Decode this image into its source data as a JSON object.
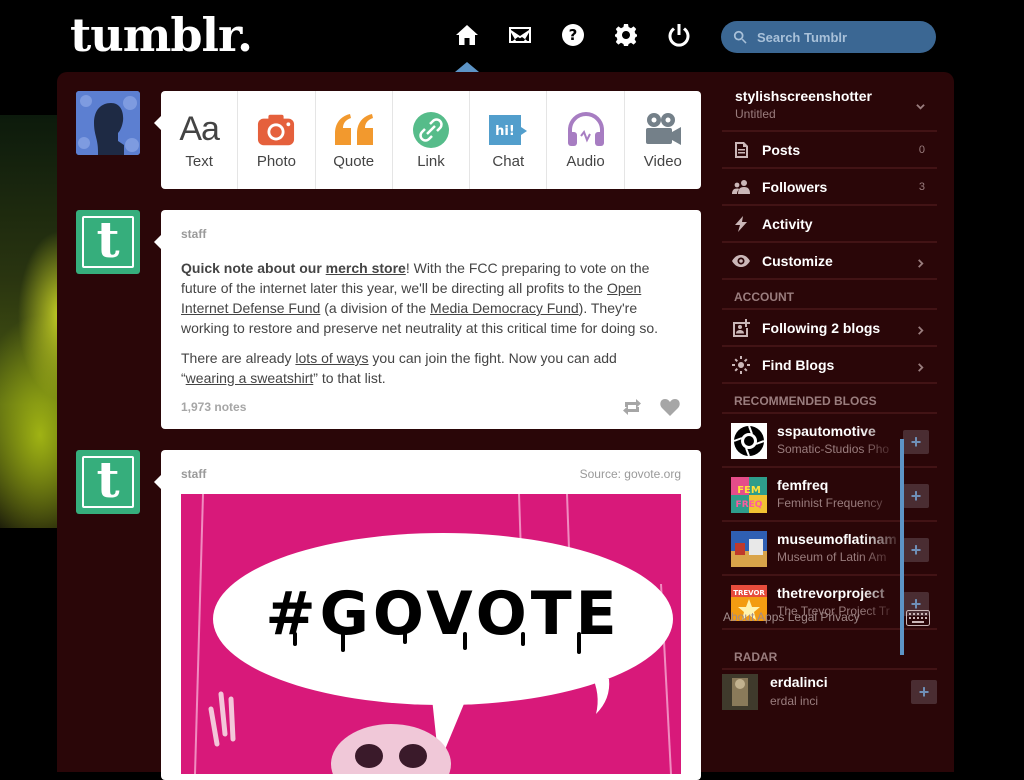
{
  "header": {
    "logo": "tumblr.",
    "nav": [
      {
        "id": "home",
        "icon": "home-icon"
      },
      {
        "id": "inbox",
        "icon": "envelope-icon"
      },
      {
        "id": "help",
        "icon": "question-icon"
      },
      {
        "id": "settings",
        "icon": "gear-icon"
      },
      {
        "id": "logout",
        "icon": "power-icon"
      }
    ],
    "search_placeholder": "Search Tumblr"
  },
  "post_types": [
    {
      "label": "Text",
      "icon": "text-icon",
      "color": "#444444"
    },
    {
      "label": "Photo",
      "icon": "camera-icon",
      "color": "#e5603c"
    },
    {
      "label": "Quote",
      "icon": "quote-icon",
      "color": "#f2992e"
    },
    {
      "label": "Link",
      "icon": "link-icon",
      "color": "#56bc8a"
    },
    {
      "label": "Chat",
      "icon": "chat-icon",
      "color": "#529ecc"
    },
    {
      "label": "Audio",
      "icon": "headphones-icon",
      "color": "#a77dc2"
    },
    {
      "label": "Video",
      "icon": "video-camera-icon",
      "color": "#748089"
    }
  ],
  "posts": [
    {
      "blog": "staff",
      "p1_lead": "Quick note about our ",
      "p1_link1": "merch store",
      "p1_after1": "! With the FCC preparing to vote on the future of the internet later this year, we'll be directing all profits to the ",
      "p1_link2": "Open Internet Defense Fund",
      "p1_after2": " (a division of the ",
      "p1_link3": "Media Democracy Fund",
      "p1_after3": "). They're working to restore and preserve net neutrality at this critical time for doing so.",
      "p2_lead": "There are already ",
      "p2_link1": "lots of ways",
      "p2_after1": " you can join the fight. Now you can add “",
      "p2_link2": "wearing a sweatshirt",
      "p2_after2": "” to that list.",
      "notes": "1,973 notes"
    },
    {
      "blog": "staff",
      "source": "Source: govote.org",
      "image_text": "#GOVOTE"
    }
  ],
  "sidebar": {
    "blog_name": "stylishscreenshotter",
    "blog_title": "Untitled",
    "items": [
      {
        "label": "Posts",
        "count": "0",
        "icon": "document-icon"
      },
      {
        "label": "Followers",
        "count": "3",
        "icon": "users-icon"
      },
      {
        "label": "Activity",
        "icon": "lightning-icon"
      },
      {
        "label": "Customize",
        "icon": "eye-icon"
      }
    ],
    "account_header": "ACCOUNT",
    "account_items": [
      {
        "label": "Following 2 blogs",
        "icon": "following-icon"
      },
      {
        "label": "Find Blogs",
        "icon": "compass-icon"
      }
    ],
    "recommended_header": "RECOMMENDED BLOGS",
    "recommended": [
      {
        "name": "sspautomotive",
        "desc": "Somatic-Studios Pho"
      },
      {
        "name": "femfreq",
        "desc": "Feminist Frequency"
      },
      {
        "name": "museumoflatinam",
        "desc": "Museum of Latin Am"
      },
      {
        "name": "thetrevorproject",
        "desc": "The Trevor Project Tr"
      }
    ],
    "footer_overlay": "About  Apps  Legal  Privacy",
    "radar_header": "RADAR",
    "radar": {
      "name": "erdalinci",
      "desc": "erdal inci"
    }
  }
}
